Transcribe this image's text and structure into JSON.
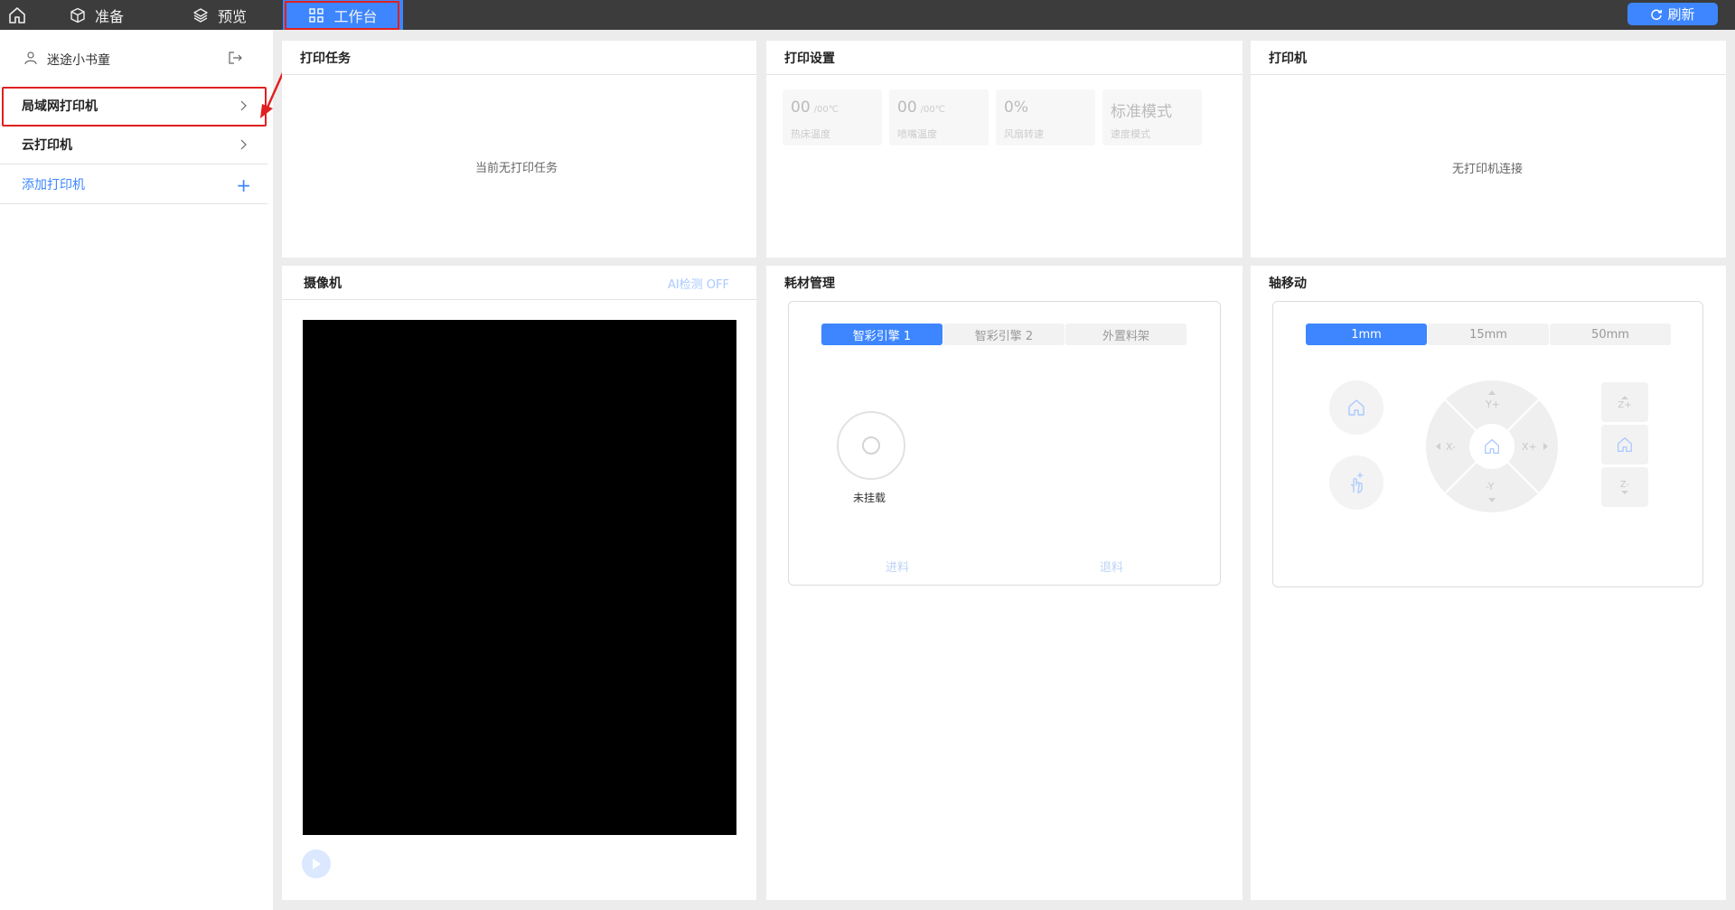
{
  "topbar": {
    "tabs": [
      {
        "label": "准备"
      },
      {
        "label": "预览"
      },
      {
        "label": "工作台"
      }
    ],
    "refresh_label": "刷新"
  },
  "sidebar": {
    "user_name": "迷途小书童",
    "items": [
      {
        "label": "局域网打印机"
      },
      {
        "label": "云打印机"
      },
      {
        "label": "添加打印机"
      }
    ]
  },
  "print_task": {
    "title": "打印任务",
    "empty_text": "当前无打印任务"
  },
  "print_settings": {
    "title": "打印设置",
    "stats": [
      {
        "value": "00",
        "unit": "/00℃",
        "label": "热床温度"
      },
      {
        "value": "00",
        "unit": "/00℃",
        "label": "喷嘴温度"
      },
      {
        "value": "0%",
        "unit": "",
        "label": "风扇转速"
      },
      {
        "value": "标准模式",
        "unit": "",
        "label": "速度模式"
      }
    ]
  },
  "printer": {
    "title": "打印机",
    "empty_text": "无打印机连接"
  },
  "camera": {
    "title": "摄像机",
    "ai_toggle": "AI检测 OFF"
  },
  "filament": {
    "title": "耗材管理",
    "tabs": [
      {
        "label": "智彩引擎 1",
        "active": true
      },
      {
        "label": "智彩引擎 2",
        "active": false
      },
      {
        "label": "外置料架",
        "active": false
      }
    ],
    "spool_label": "未挂载",
    "load_label": "进料",
    "unload_label": "退料"
  },
  "axis": {
    "title": "轴移动",
    "steps": [
      {
        "label": "1mm",
        "active": true
      },
      {
        "label": "15mm",
        "active": false
      },
      {
        "label": "50mm",
        "active": false
      }
    ],
    "labels": {
      "y_plus": "Y+",
      "y_minus": "-Y",
      "x_minus": "X-",
      "x_plus": "X+",
      "z_plus": "Z+",
      "z_minus": "Z-"
    }
  },
  "colors": {
    "accent": "#3d86ff",
    "topbar": "#3c3c3c",
    "highlight": "#e02020"
  }
}
